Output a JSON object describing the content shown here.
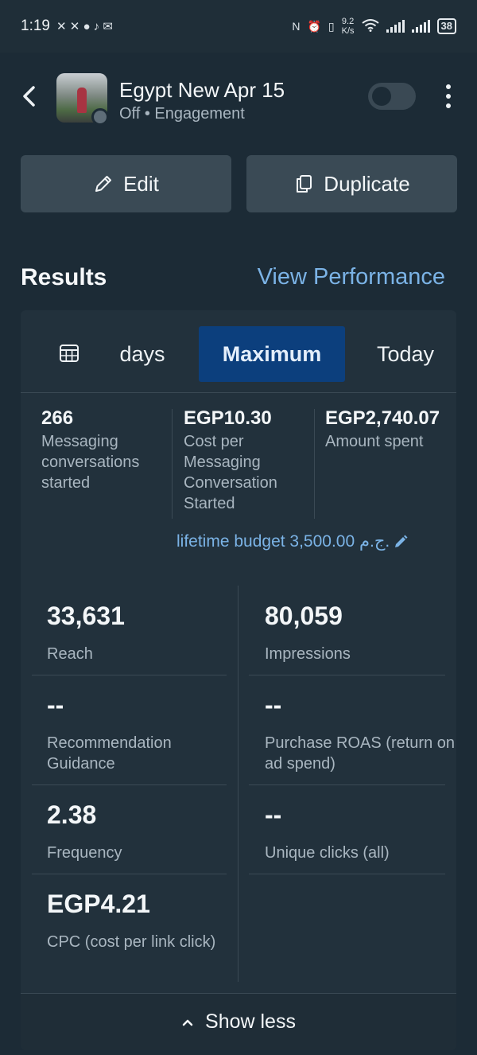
{
  "status_bar": {
    "time": "1:19",
    "network_speed_value": "9.2",
    "network_speed_unit": "K/s",
    "battery": "38"
  },
  "header": {
    "campaign_name": "Egypt New Apr 15",
    "status_line": "Off • Engagement",
    "toggle_on": false
  },
  "actions": {
    "edit_label": "Edit",
    "duplicate_label": "Duplicate"
  },
  "results": {
    "title": "Results",
    "view_performance_label": "View Performance",
    "date_segments": {
      "days_label": "days",
      "maximum_label": "Maximum",
      "today_label": "Today",
      "selected": "Maximum"
    },
    "summary_metrics": [
      {
        "value": "266",
        "label": "Messaging conversations started"
      },
      {
        "value": "EGP10.30",
        "label": "Cost per Messaging Conversation Started"
      },
      {
        "value": "EGP2,740.07",
        "label": "Amount spent"
      }
    ],
    "budget_label": "lifetime budget 3,500.00 ج.م.",
    "stats": [
      {
        "value": "33,631",
        "label": "Reach"
      },
      {
        "value": "80,059",
        "label": "Impressions"
      },
      {
        "value": "--",
        "label": "Recommendation Guidance"
      },
      {
        "value": "--",
        "label": "Purchase ROAS (return on ad spend)"
      },
      {
        "value": "2.38",
        "label": "Frequency"
      },
      {
        "value": "--",
        "label": "Unique clicks (all)"
      },
      {
        "value": "EGP4.21",
        "label": "CPC (cost per link click)"
      }
    ],
    "show_less_label": "Show less"
  },
  "colors": {
    "background": "#1c2b36",
    "card": "#22313c",
    "accent_link": "#7bb3e6",
    "selected_segment": "#0c3f7d",
    "button": "#3a4a55"
  },
  "icons": {
    "back": "chevron-left-icon",
    "more": "kebab-menu-icon",
    "edit": "pencil-icon",
    "duplicate": "copy-icon",
    "calendar": "calendar-icon",
    "budget_edit": "pencil-icon",
    "show_less": "chevron-up-icon"
  }
}
